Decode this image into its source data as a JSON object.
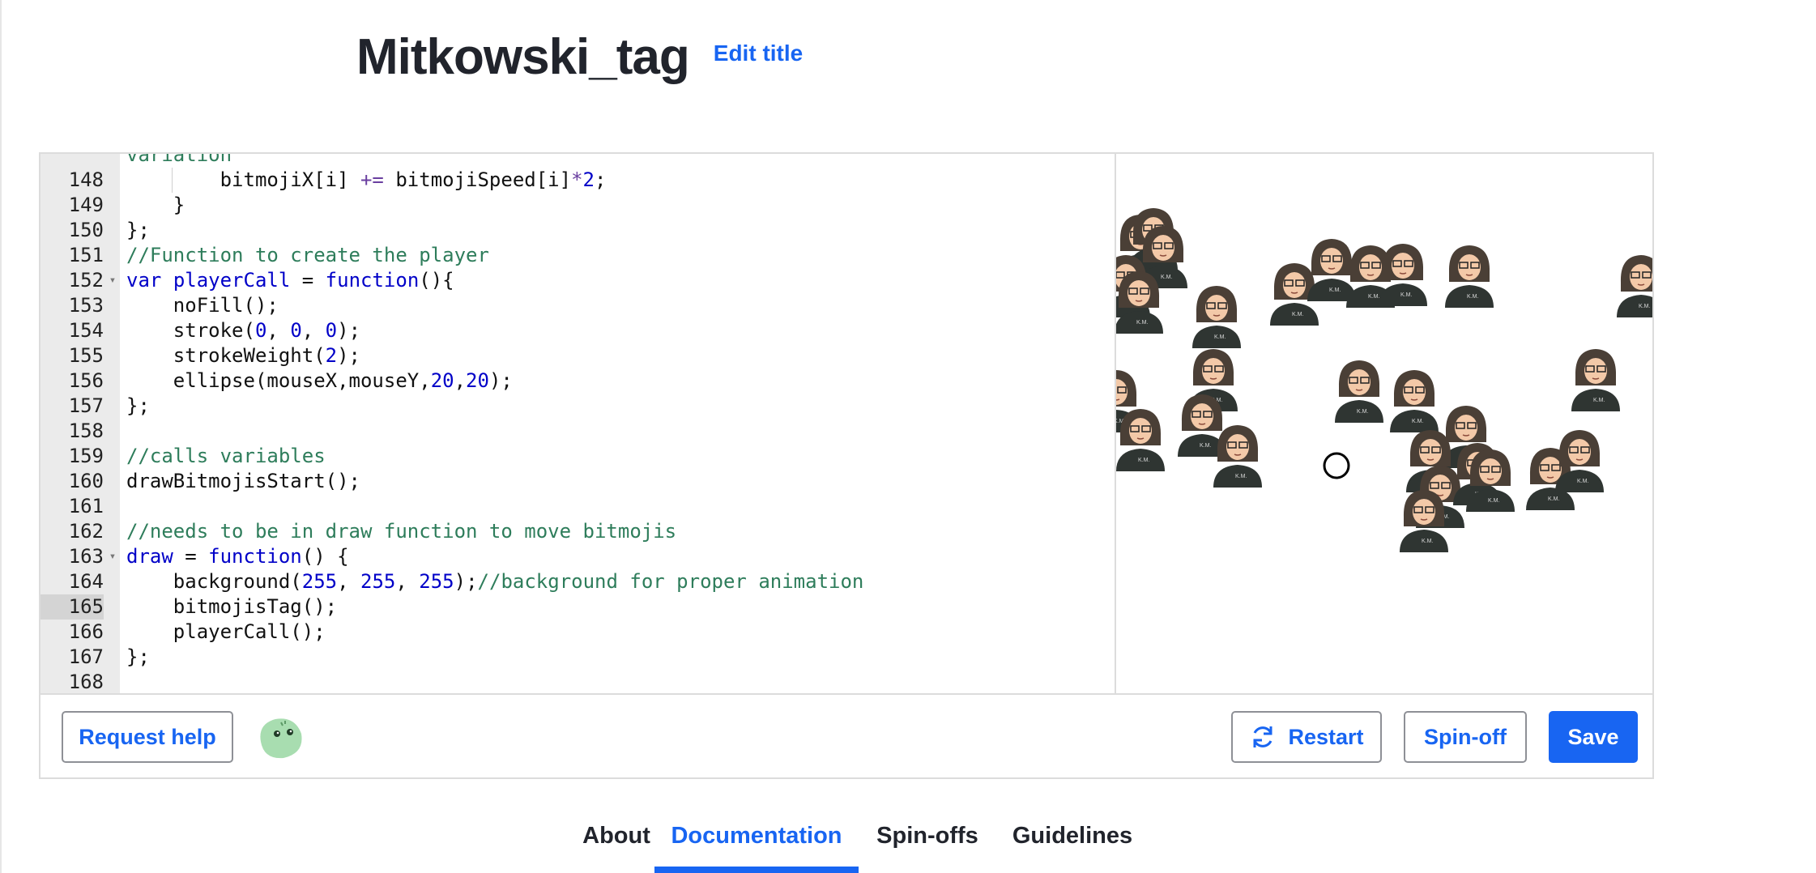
{
  "header": {
    "title": "Mitkowski_tag",
    "edit_title_label": "Edit title"
  },
  "editor": {
    "active_line": "165",
    "lines": [
      {
        "n": "",
        "parts": [
          [
            "cm",
            "variation"
          ]
        ]
      },
      {
        "n": "148",
        "guide": true,
        "parts": [
          [
            "t",
            "        bitmojiX[i] "
          ],
          [
            "op",
            "+="
          ],
          [
            "t",
            " bitmojiSpeed[i]"
          ],
          [
            "op",
            "*"
          ],
          [
            "num",
            "2"
          ],
          [
            "t",
            ";"
          ]
        ]
      },
      {
        "n": "149",
        "parts": [
          [
            "t",
            "    }"
          ]
        ]
      },
      {
        "n": "150",
        "parts": [
          [
            "t",
            "};"
          ]
        ]
      },
      {
        "n": "151",
        "parts": [
          [
            "cm",
            "//Function to create the player"
          ]
        ]
      },
      {
        "n": "152",
        "fold": true,
        "parts": [
          [
            "kw",
            "var"
          ],
          [
            "t",
            " "
          ],
          [
            "kw",
            "playerCall"
          ],
          [
            "t",
            " = "
          ],
          [
            "kw",
            "function"
          ],
          [
            "t",
            "(){"
          ]
        ]
      },
      {
        "n": "153",
        "parts": [
          [
            "t",
            "    noFill();"
          ]
        ]
      },
      {
        "n": "154",
        "parts": [
          [
            "t",
            "    stroke("
          ],
          [
            "num",
            "0"
          ],
          [
            "t",
            ", "
          ],
          [
            "num",
            "0"
          ],
          [
            "t",
            ", "
          ],
          [
            "num",
            "0"
          ],
          [
            "t",
            ");"
          ]
        ]
      },
      {
        "n": "155",
        "parts": [
          [
            "t",
            "    strokeWeight("
          ],
          [
            "num",
            "2"
          ],
          [
            "t",
            ");"
          ]
        ]
      },
      {
        "n": "156",
        "parts": [
          [
            "t",
            "    ellipse(mouseX,mouseY,"
          ],
          [
            "num",
            "20"
          ],
          [
            "t",
            ","
          ],
          [
            "num",
            "20"
          ],
          [
            "t",
            ");"
          ]
        ]
      },
      {
        "n": "157",
        "parts": [
          [
            "t",
            "};"
          ]
        ]
      },
      {
        "n": "158",
        "parts": []
      },
      {
        "n": "159",
        "parts": [
          [
            "cm",
            "//calls variables"
          ]
        ]
      },
      {
        "n": "160",
        "parts": [
          [
            "t",
            "drawBitmojisStart();"
          ]
        ]
      },
      {
        "n": "161",
        "parts": []
      },
      {
        "n": "162",
        "parts": [
          [
            "cm",
            "//needs to be in draw function to move bitmojis"
          ]
        ]
      },
      {
        "n": "163",
        "fold": true,
        "parts": [
          [
            "kw",
            "draw"
          ],
          [
            "t",
            " = "
          ],
          [
            "kw",
            "function"
          ],
          [
            "t",
            "() {"
          ]
        ]
      },
      {
        "n": "164",
        "parts": [
          [
            "t",
            "    background("
          ],
          [
            "num",
            "255"
          ],
          [
            "t",
            ", "
          ],
          [
            "num",
            "255"
          ],
          [
            "t",
            ", "
          ],
          [
            "num",
            "255"
          ],
          [
            "t",
            ");"
          ],
          [
            "cm",
            "//background for proper animation"
          ]
        ]
      },
      {
        "n": "165",
        "parts": [
          [
            "t",
            "    bitmojisTag();"
          ]
        ]
      },
      {
        "n": "166",
        "parts": [
          [
            "t",
            "    playerCall();"
          ]
        ]
      },
      {
        "n": "167",
        "parts": [
          [
            "t",
            "};"
          ]
        ]
      },
      {
        "n": "168",
        "parts": []
      }
    ]
  },
  "output": {
    "sprite_caption": "K.M."
  },
  "toolbar": {
    "request_help_label": "Request help",
    "restart_label": "Restart",
    "spinoff_label": "Spin-off",
    "save_label": "Save"
  },
  "tabs": [
    {
      "label": "About"
    },
    {
      "label": "Documentation",
      "active": true
    },
    {
      "label": "Spin-offs"
    },
    {
      "label": "Guidelines"
    }
  ],
  "colors": {
    "accent": "#1865f2",
    "comment": "#2e7d5b",
    "keyword": "#0000c8"
  }
}
